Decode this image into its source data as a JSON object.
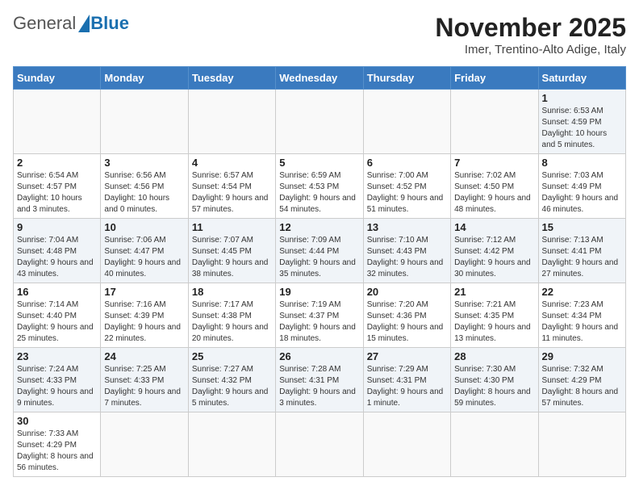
{
  "header": {
    "logo": {
      "general": "General",
      "blue": "Blue"
    },
    "title": "November 2025",
    "subtitle": "Imer, Trentino-Alto Adige, Italy"
  },
  "days_of_week": [
    "Sunday",
    "Monday",
    "Tuesday",
    "Wednesday",
    "Thursday",
    "Friday",
    "Saturday"
  ],
  "weeks": [
    [
      {
        "num": "",
        "info": ""
      },
      {
        "num": "",
        "info": ""
      },
      {
        "num": "",
        "info": ""
      },
      {
        "num": "",
        "info": ""
      },
      {
        "num": "",
        "info": ""
      },
      {
        "num": "",
        "info": ""
      },
      {
        "num": "1",
        "info": "Sunrise: 6:53 AM\nSunset: 4:59 PM\nDaylight: 10 hours and 5 minutes."
      }
    ],
    [
      {
        "num": "2",
        "info": "Sunrise: 6:54 AM\nSunset: 4:57 PM\nDaylight: 10 hours and 3 minutes."
      },
      {
        "num": "3",
        "info": "Sunrise: 6:56 AM\nSunset: 4:56 PM\nDaylight: 10 hours and 0 minutes."
      },
      {
        "num": "4",
        "info": "Sunrise: 6:57 AM\nSunset: 4:54 PM\nDaylight: 9 hours and 57 minutes."
      },
      {
        "num": "5",
        "info": "Sunrise: 6:59 AM\nSunset: 4:53 PM\nDaylight: 9 hours and 54 minutes."
      },
      {
        "num": "6",
        "info": "Sunrise: 7:00 AM\nSunset: 4:52 PM\nDaylight: 9 hours and 51 minutes."
      },
      {
        "num": "7",
        "info": "Sunrise: 7:02 AM\nSunset: 4:50 PM\nDaylight: 9 hours and 48 minutes."
      },
      {
        "num": "8",
        "info": "Sunrise: 7:03 AM\nSunset: 4:49 PM\nDaylight: 9 hours and 46 minutes."
      }
    ],
    [
      {
        "num": "9",
        "info": "Sunrise: 7:04 AM\nSunset: 4:48 PM\nDaylight: 9 hours and 43 minutes."
      },
      {
        "num": "10",
        "info": "Sunrise: 7:06 AM\nSunset: 4:47 PM\nDaylight: 9 hours and 40 minutes."
      },
      {
        "num": "11",
        "info": "Sunrise: 7:07 AM\nSunset: 4:45 PM\nDaylight: 9 hours and 38 minutes."
      },
      {
        "num": "12",
        "info": "Sunrise: 7:09 AM\nSunset: 4:44 PM\nDaylight: 9 hours and 35 minutes."
      },
      {
        "num": "13",
        "info": "Sunrise: 7:10 AM\nSunset: 4:43 PM\nDaylight: 9 hours and 32 minutes."
      },
      {
        "num": "14",
        "info": "Sunrise: 7:12 AM\nSunset: 4:42 PM\nDaylight: 9 hours and 30 minutes."
      },
      {
        "num": "15",
        "info": "Sunrise: 7:13 AM\nSunset: 4:41 PM\nDaylight: 9 hours and 27 minutes."
      }
    ],
    [
      {
        "num": "16",
        "info": "Sunrise: 7:14 AM\nSunset: 4:40 PM\nDaylight: 9 hours and 25 minutes."
      },
      {
        "num": "17",
        "info": "Sunrise: 7:16 AM\nSunset: 4:39 PM\nDaylight: 9 hours and 22 minutes."
      },
      {
        "num": "18",
        "info": "Sunrise: 7:17 AM\nSunset: 4:38 PM\nDaylight: 9 hours and 20 minutes."
      },
      {
        "num": "19",
        "info": "Sunrise: 7:19 AM\nSunset: 4:37 PM\nDaylight: 9 hours and 18 minutes."
      },
      {
        "num": "20",
        "info": "Sunrise: 7:20 AM\nSunset: 4:36 PM\nDaylight: 9 hours and 15 minutes."
      },
      {
        "num": "21",
        "info": "Sunrise: 7:21 AM\nSunset: 4:35 PM\nDaylight: 9 hours and 13 minutes."
      },
      {
        "num": "22",
        "info": "Sunrise: 7:23 AM\nSunset: 4:34 PM\nDaylight: 9 hours and 11 minutes."
      }
    ],
    [
      {
        "num": "23",
        "info": "Sunrise: 7:24 AM\nSunset: 4:33 PM\nDaylight: 9 hours and 9 minutes."
      },
      {
        "num": "24",
        "info": "Sunrise: 7:25 AM\nSunset: 4:33 PM\nDaylight: 9 hours and 7 minutes."
      },
      {
        "num": "25",
        "info": "Sunrise: 7:27 AM\nSunset: 4:32 PM\nDaylight: 9 hours and 5 minutes."
      },
      {
        "num": "26",
        "info": "Sunrise: 7:28 AM\nSunset: 4:31 PM\nDaylight: 9 hours and 3 minutes."
      },
      {
        "num": "27",
        "info": "Sunrise: 7:29 AM\nSunset: 4:31 PM\nDaylight: 9 hours and 1 minute."
      },
      {
        "num": "28",
        "info": "Sunrise: 7:30 AM\nSunset: 4:30 PM\nDaylight: 8 hours and 59 minutes."
      },
      {
        "num": "29",
        "info": "Sunrise: 7:32 AM\nSunset: 4:29 PM\nDaylight: 8 hours and 57 minutes."
      }
    ],
    [
      {
        "num": "30",
        "info": "Sunrise: 7:33 AM\nSunset: 4:29 PM\nDaylight: 8 hours and 56 minutes."
      },
      {
        "num": "",
        "info": ""
      },
      {
        "num": "",
        "info": ""
      },
      {
        "num": "",
        "info": ""
      },
      {
        "num": "",
        "info": ""
      },
      {
        "num": "",
        "info": ""
      },
      {
        "num": "",
        "info": ""
      }
    ]
  ],
  "row_styles": [
    "row-stripe",
    "row-white",
    "row-stripe",
    "row-white",
    "row-stripe",
    "row-white"
  ]
}
